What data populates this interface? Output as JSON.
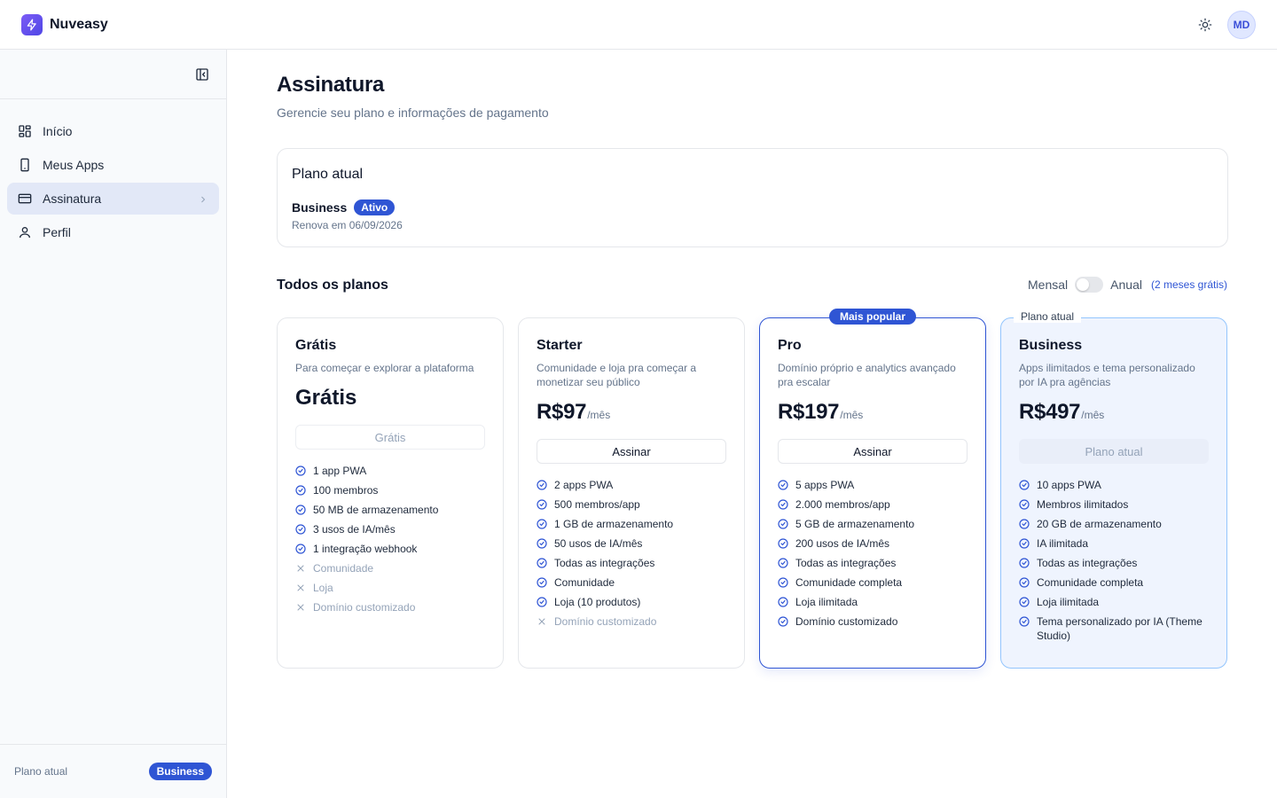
{
  "app": {
    "brand": "Nuveasy",
    "avatar_initials": "MD"
  },
  "sidebar": {
    "items": [
      {
        "label": "Início",
        "icon": "grid-icon"
      },
      {
        "label": "Meus Apps",
        "icon": "phone-icon"
      },
      {
        "label": "Assinatura",
        "icon": "card-icon",
        "active": true
      },
      {
        "label": "Perfil",
        "icon": "user-icon"
      }
    ],
    "footer_label": "Plano atual",
    "footer_badge": "Business"
  },
  "page": {
    "title": "Assinatura",
    "subtitle": "Gerencie seu plano e informações de pagamento"
  },
  "current_plan": {
    "title": "Plano atual",
    "name": "Business",
    "status": "Ativo",
    "renewal": "Renova em 06/09/2026"
  },
  "plans_section": {
    "title": "Todos os planos",
    "monthly": "Mensal",
    "annual": "Anual",
    "promo": "(2 meses grátis)"
  },
  "plans": [
    {
      "name": "Grátis",
      "desc": "Para começar e explorar a plataforma",
      "price_label": "Grátis",
      "button": "Grátis",
      "features": [
        {
          "text": "1 app PWA",
          "on": true
        },
        {
          "text": "100 membros",
          "on": true
        },
        {
          "text": "50 MB de armazenamento",
          "on": true
        },
        {
          "text": "3 usos de IA/mês",
          "on": true
        },
        {
          "text": "1 integração webhook",
          "on": true
        },
        {
          "text": "Comunidade",
          "on": false
        },
        {
          "text": "Loja",
          "on": false
        },
        {
          "text": "Domínio customizado",
          "on": false
        }
      ]
    },
    {
      "name": "Starter",
      "desc": "Comunidade e loja pra começar a monetizar seu público",
      "price": "R$97",
      "unit": "/mês",
      "button": "Assinar",
      "features": [
        {
          "text": "2 apps PWA",
          "on": true
        },
        {
          "text": "500 membros/app",
          "on": true
        },
        {
          "text": "1 GB de armazenamento",
          "on": true
        },
        {
          "text": "50 usos de IA/mês",
          "on": true
        },
        {
          "text": "Todas as integrações",
          "on": true
        },
        {
          "text": "Comunidade",
          "on": true
        },
        {
          "text": "Loja (10 produtos)",
          "on": true
        },
        {
          "text": "Domínio customizado",
          "on": false
        }
      ]
    },
    {
      "name": "Pro",
      "ribbon": "Mais popular",
      "desc": "Domínio próprio e analytics avançado pra escalar",
      "price": "R$197",
      "unit": "/mês",
      "button": "Assinar",
      "features": [
        {
          "text": "5 apps PWA",
          "on": true
        },
        {
          "text": "2.000 membros/app",
          "on": true
        },
        {
          "text": "5 GB de armazenamento",
          "on": true
        },
        {
          "text": "200 usos de IA/mês",
          "on": true
        },
        {
          "text": "Todas as integrações",
          "on": true
        },
        {
          "text": "Comunidade completa",
          "on": true
        },
        {
          "text": "Loja ilimitada",
          "on": true
        },
        {
          "text": "Domínio customizado",
          "on": true
        }
      ]
    },
    {
      "name": "Business",
      "ribbon": "Plano atual",
      "desc": "Apps ilimitados e tema personalizado por IA pra agências",
      "price": "R$497",
      "unit": "/mês",
      "button": "Plano atual",
      "features": [
        {
          "text": "10 apps PWA",
          "on": true
        },
        {
          "text": "Membros ilimitados",
          "on": true
        },
        {
          "text": "20 GB de armazenamento",
          "on": true
        },
        {
          "text": "IA ilimitada",
          "on": true
        },
        {
          "text": "Todas as integrações",
          "on": true
        },
        {
          "text": "Comunidade completa",
          "on": true
        },
        {
          "text": "Loja ilimitada",
          "on": true
        },
        {
          "text": "Tema personalizado por IA (Theme Studio)",
          "on": true
        }
      ]
    }
  ],
  "colors": {
    "accent": "#2f55d4",
    "muted": "#64748b"
  }
}
